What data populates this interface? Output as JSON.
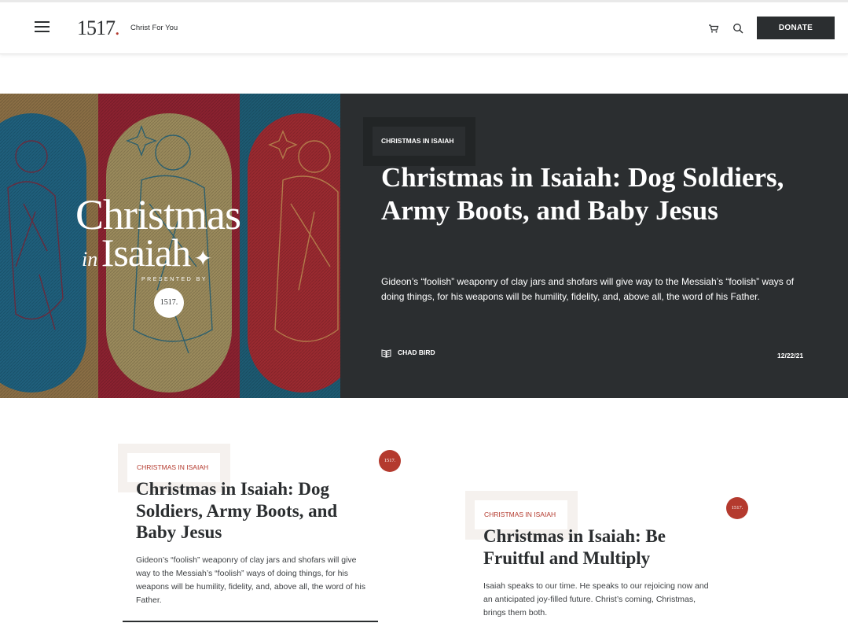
{
  "header": {
    "logo_text": "1517",
    "logo_dot": ".",
    "tagline": "Christ For You",
    "donate_label": "DONATE"
  },
  "hero": {
    "art": {
      "word1": "Christmas",
      "word2": "in",
      "word3": "Isaiah",
      "presented": "PRESENTED BY",
      "badge": "1517."
    },
    "category": "CHRISTMAS IN ISAIAH",
    "title": "Christmas in Isaiah: Dog Soldiers, Army Boots, and Baby Jesus",
    "summary": "Gideon’s “foolish” weaponry of clay jars and shofars will give way to the Messiah’s “foolish” ways of doing things, for his weapons will be humility, fidelity, and, above all, the word of his Father.",
    "author": "CHAD BIRD",
    "date": "12/22/21"
  },
  "cards": [
    {
      "category": "CHRISTMAS IN ISAIAH",
      "badge": "1517.",
      "title": "Christmas in Isaiah: Dog Soldiers, Army Boots, and Baby Jesus",
      "summary": "Gideon’s “foolish” weaponry of clay jars and shofars will give way to the Messiah’s “foolish” ways of doing things, for his weapons will be humility, fidelity, and, above all, the word of his Father."
    },
    {
      "category": "CHRISTMAS IN ISAIAH",
      "badge": "1517.",
      "title": "Christmas in Isaiah: Be Fruitful and Multiply",
      "summary": "Isaiah speaks to our time. He speaks to our rejoicing now and an anticipated joy-filled future. Christ’s coming, Christmas, brings them both."
    }
  ],
  "colors": {
    "accent": "#b43a2e",
    "dark": "#2b2e30",
    "tag_bg": "#f5f1ee"
  },
  "icons": {
    "menu": "hamburger-menu-icon",
    "cart": "cart-icon",
    "search": "search-icon",
    "author": "book-icon"
  }
}
